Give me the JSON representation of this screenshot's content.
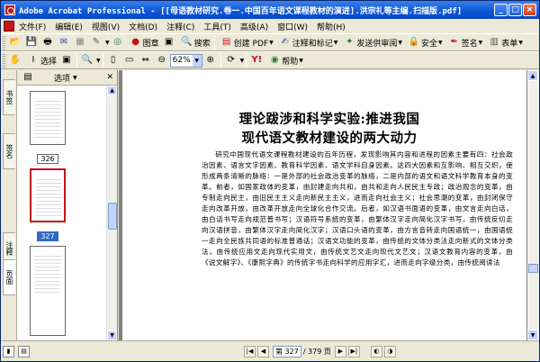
{
  "window": {
    "title": "Adobe Acrobat Professional - [[母语教材研究.卷一.中国百年语文课程教材的演进].洪宗礼等主编.扫描版.pdf]",
    "controls": [
      "_",
      "□",
      "×"
    ]
  },
  "menu": {
    "items": [
      "文件(F)",
      "编辑(E)",
      "视图(V)",
      "文档(D)",
      "注释(C)",
      "工具(T)",
      "高级(A)",
      "窗口(W)",
      "帮助(H)"
    ]
  },
  "toolbar1": {
    "legend_label": "图章",
    "search_label": "搜索",
    "create_pdf_label": "创建 PDF",
    "comment_label": "注释和标记",
    "send_review_label": "发送供审阅",
    "security_label": "安全",
    "sign_label": "签名",
    "forms_label": "表单"
  },
  "toolbar2": {
    "select_label": "选择",
    "zoom_value": "62%",
    "help_label": "帮助"
  },
  "nav_tabs": [
    "书签",
    "签名",
    "注释",
    "页面"
  ],
  "pages_panel": {
    "options_label": "选项",
    "thumbnails": [
      {
        "label": "326",
        "selected": false
      },
      {
        "label": "327",
        "selected": true
      },
      {
        "label": "",
        "selected": false
      }
    ]
  },
  "document": {
    "title_line1": "理论跋涉和科学实验:推进我国",
    "title_line2": "现代语文教材建设的两大动力",
    "body": "研究中国现代语文课程教材建设的百年历程，发现影响其内容和进程的因素主要有四：社会政治因素、语言文字因素、教育科学因素、语文学科自身因素。这四大因素和互影响、相互交织，使形成两条清晰的脉络：一是外部的社会政治变革的脉络，二是内部的语文和语文科学教育本身的变革。前者，如国家政体的变革，由封建走向共和，由共和走向人民民主专政；政治观念的变革，由专制走向民主，由旧民主主义走向新民主主义，进而走向社会主义；社会思潮的变革，由封闭保守走向改革开放，由改革开放走向全球化合作交流。后者，如汉语书面语的变革，由文言走向白话，由白话书写走向规范普书写；汉语符号系统的变革，由繁体汉字走向简化汉字书写，由传统反切走向汉语拼音，由繁体汉字走向简化汉字；汉语口头语的变革，由方言音转走向国语统一，由国语统一走向全民族共同语的标准普通话；汉语文功能的变革，由传统的文体分类法走向新式的文体分类法，由传统应用文走向现代实用文，由传统文艺文走向现代文艺文；汉语文教育内容的变革，由《说文解字》、《康熙字典》的传统字书走向科学的应用字汇，进而走向字级分类，由传统阅读法"
  },
  "statusbar": {
    "page_current": "第 327",
    "page_total": "/ 379 页"
  }
}
